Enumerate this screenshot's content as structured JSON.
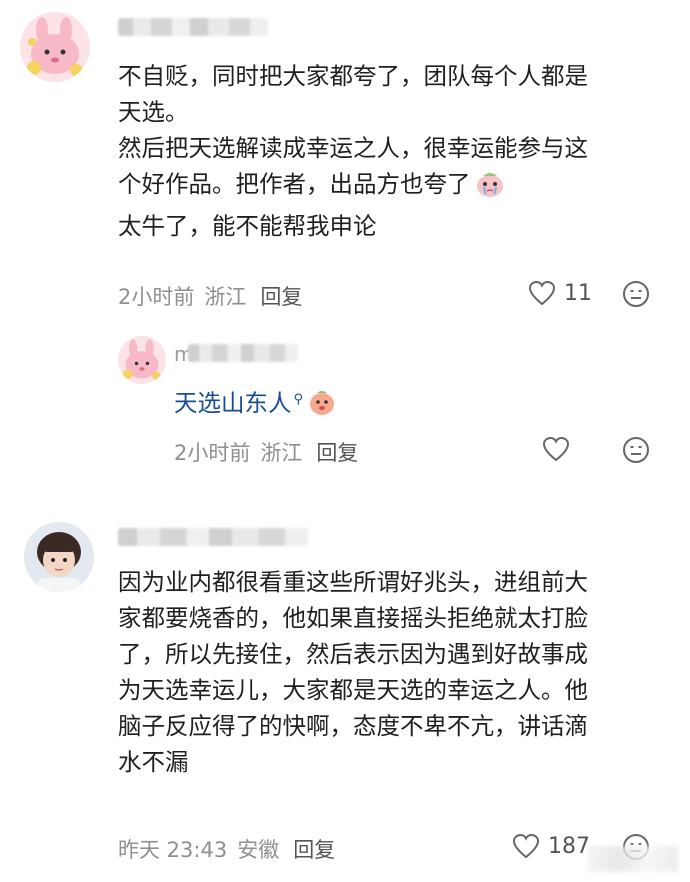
{
  "comments": [
    {
      "avatar": "pink-bunny-avatar",
      "text_lines": [
        "不自贬，同时把大家都夸了，团队每个人都是",
        "天选。",
        "然后把天选解读成幸运之人，很幸运能参与这",
        "个好作品。把作者，出品方也夸了",
        "太牛了，能不能帮我申论"
      ],
      "inline_emoji": "crying-emoji",
      "time": "2小时前",
      "location": "浙江",
      "reply_label": "回复",
      "like_count": "11",
      "reply": {
        "avatar": "pink-bunny-avatar",
        "name_prefix": "m",
        "text": "天选山东人",
        "inline_emoji": "peach-emoji",
        "time": "2小时前",
        "location": "浙江",
        "reply_label": "回复"
      }
    },
    {
      "avatar": "child-photo-avatar",
      "text_lines": [
        "因为业内都很看重这些所谓好兆头，进组前大",
        "家都要烧香的，他如果直接摇头拒绝就太打脸",
        "了，所以先接住，然后表示因为遇到好故事成",
        "为天选幸运儿，大家都是天选的幸运之人。他",
        "脑子反应得了的快啊，态度不卑不亢，讲话滴",
        "水不漏"
      ],
      "time": "昨天 23:43",
      "location": "安徽",
      "reply_label": "回复",
      "like_count": "187"
    }
  ],
  "colors": {
    "text": "#1f1f1f",
    "meta": "#8f8f8f",
    "link": "#1a4d8f"
  }
}
